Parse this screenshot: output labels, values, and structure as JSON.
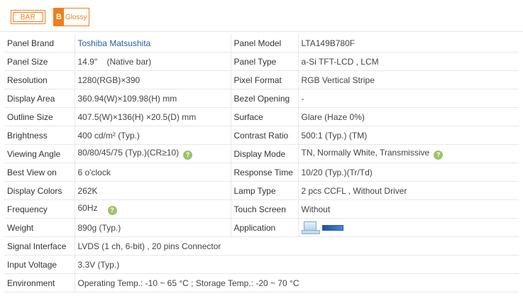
{
  "badges": {
    "bar": "BAR",
    "glossy_logo": "B",
    "glossy": "Glossy"
  },
  "rows": [
    {
      "k1": "Panel Brand",
      "v1": "Toshiba Matsushita",
      "k2": "Panel Model",
      "v2": "LTA149B780F"
    },
    {
      "k1": "Panel Size",
      "v1": "14.9\"    (Native bar)",
      "k2": "Panel Type",
      "v2": "a-Si TFT-LCD , LCM"
    },
    {
      "k1": "Resolution",
      "v1": "1280(RGB)×390",
      "k2": "Pixel Format",
      "v2": "RGB Vertical Stripe"
    },
    {
      "k1": "Display Area",
      "v1": "360.94(W)×109.98(H) mm",
      "k2": "Bezel Opening",
      "v2": "-"
    },
    {
      "k1": "Outline Size",
      "v1": "407.5(W)×136(H) ×20.5(D) mm",
      "k2": "Surface",
      "v2": "Glare (Haze 0%)"
    },
    {
      "k1": "Brightness",
      "v1": "400 cd/m² (Typ.)",
      "k2": "Contrast Ratio",
      "v2": "500:1 (Typ.) (TM)"
    },
    {
      "k1": "Viewing Angle",
      "v1": "80/80/45/75 (Typ.)(CR≥10)",
      "k2": "Display Mode",
      "v2": "TN, Normally White, Transmissive"
    },
    {
      "k1": "Best View on",
      "v1": "6 o'clock",
      "k2": "Response Time",
      "v2": "10/20 (Typ.)(Tr/Td)"
    },
    {
      "k1": "Display Colors",
      "v1": "262K",
      "k2": "Lamp Type",
      "v2": "2 pcs CCFL , Without Driver"
    },
    {
      "k1": "Frequency",
      "v1": "60Hz",
      "k2": "Touch Screen",
      "v2": "Without"
    },
    {
      "k1": "Weight",
      "v1": "890g (Typ.)",
      "k2": "Application",
      "v2": ""
    }
  ],
  "wide_rows": [
    {
      "k": "Signal Interface",
      "v": "LVDS (1 ch, 6-bit) , 20 pins Connector"
    },
    {
      "k": "Input Voltage",
      "v": "3.3V (Typ.)"
    },
    {
      "k": "Environment",
      "v": "Operating Temp.: -10 ~ 65 °C ; Storage Temp.: -20 ~ 70 °C"
    }
  ],
  "help_glyph": "?",
  "colors": {
    "accent": "#f07f1a",
    "brand_link": "#2a5ea8",
    "help": "#9fc36a"
  }
}
